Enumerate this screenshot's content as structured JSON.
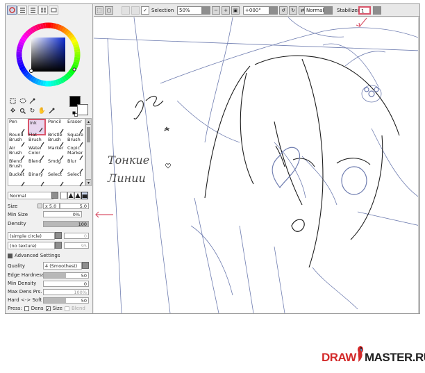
{
  "toolbar": {
    "selection_label": "Selection",
    "zoom": "50%",
    "rotation": "+000°",
    "blend_mode": "Normal",
    "stabilizer_label": "Stabilizer",
    "stabilizer_value": "1"
  },
  "tools_brushes": [
    {
      "label": "Pen",
      "icon": "pen-icon"
    },
    {
      "label": "Ink",
      "icon": "ink-icon",
      "selected": true
    },
    {
      "label": "Pencil",
      "icon": "pencil-icon"
    },
    {
      "label": "Eraser",
      "icon": "eraser-icon"
    },
    {
      "label": "Round Brush",
      "icon": "round-brush-icon"
    },
    {
      "label": "Flat Brush",
      "icon": "flat-brush-icon"
    },
    {
      "label": "Bristle Brush",
      "icon": "bristle-brush-icon"
    },
    {
      "label": "Square Brush",
      "icon": "square-brush-icon"
    },
    {
      "label": "Air Brush",
      "icon": "air-brush-icon"
    },
    {
      "label": "Water Color",
      "icon": "water-color-icon"
    },
    {
      "label": "Marker",
      "icon": "marker-icon"
    },
    {
      "label": "Copic Marker",
      "icon": "copic-marker-icon"
    },
    {
      "label": "Blend Brush",
      "icon": "blend-brush-icon"
    },
    {
      "label": "Blend",
      "icon": "blend-icon"
    },
    {
      "label": "Smdg",
      "icon": "smudge-icon"
    },
    {
      "label": "Blur",
      "icon": "blur-icon"
    },
    {
      "label": "Bucket",
      "icon": "bucket-icon"
    },
    {
      "label": "Binary",
      "icon": "binary-icon"
    },
    {
      "label": "Select",
      "icon": "select-icon"
    },
    {
      "label": "Select",
      "icon": "select-icon"
    }
  ],
  "brush_props": {
    "blend_mode": "Normal",
    "size_label": "Size",
    "size_mult": "x 5.0",
    "size_value": "5.0",
    "min_size_label": "Min Size",
    "min_size_value": "0%",
    "density_label": "Density",
    "density_value": "100",
    "shape": "(simple circle)",
    "shape_value": "0",
    "texture": "(no texture)",
    "texture_value": "95",
    "advanced_label": "Advanced Settings",
    "quality_label": "Quality",
    "quality_value": "4 (Smoothest)",
    "edge_hardness_label": "Edge Hardness",
    "edge_hardness_value": "50",
    "min_density_label": "Min Density",
    "min_density_value": "0",
    "max_dens_prs_label": "Max Dens Prs.",
    "max_dens_prs_value": "100%",
    "hard_soft_label": "Hard <-> Soft",
    "hard_soft_value": "50",
    "press_label": "Press:",
    "press_dens": "Dens",
    "press_size": "Size",
    "press_blend": "Blend"
  },
  "canvas_annotation": {
    "line1": "Тонкие",
    "line2": "Линии"
  },
  "watermark": {
    "text_left": "DRAW",
    "text_right": "MASTER.RU"
  },
  "colors": {
    "highlight": "#d9546a",
    "sketch_line": "#6f7db0",
    "ink_line": "#1c1c1c"
  }
}
